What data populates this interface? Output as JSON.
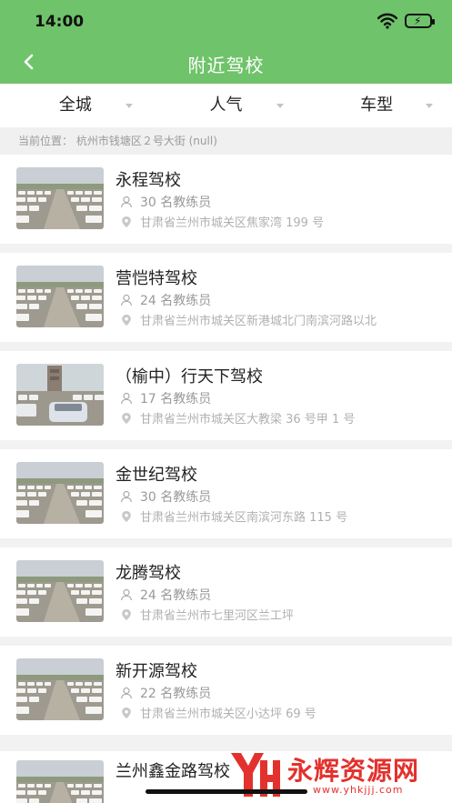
{
  "status_bar": {
    "time": "14:00"
  },
  "nav": {
    "title": "附近驾校"
  },
  "filters": [
    {
      "label": "全城"
    },
    {
      "label": "人气"
    },
    {
      "label": "车型"
    }
  ],
  "location": {
    "text": "当前位置：  杭州市钱塘区２号大街 (null)"
  },
  "schools": [
    {
      "name": "永程驾校",
      "coaches": "30 名教练员",
      "address": "甘肃省兰州市城关区焦家湾 199 号"
    },
    {
      "name": "营恺特驾校",
      "coaches": "24 名教练员",
      "address": "甘肃省兰州市城关区新港城北门南滨河路以北"
    },
    {
      "name": "（榆中）行天下驾校",
      "coaches": "17 名教练员",
      "address": "甘肃省兰州市城关区大教梁 36 号甲 1 号"
    },
    {
      "name": "金世纪驾校",
      "coaches": "30 名教练员",
      "address": "甘肃省兰州市城关区南滨河东路 115 号"
    },
    {
      "name": "龙腾驾校",
      "coaches": "24 名教练员",
      "address": "甘肃省兰州市七里河区兰工坪"
    },
    {
      "name": "新开源驾校",
      "coaches": "22 名教练员",
      "address": "甘肃省兰州市城关区小达坪 69 号"
    }
  ],
  "partial_school": {
    "name": "兰州鑫金路驾校"
  },
  "watermark": {
    "text": "永辉资源网",
    "url": "www.yhkjjj.com"
  },
  "colors": {
    "header": "#6fc36a",
    "watermark": "#e3312d"
  },
  "icons": {
    "back": "chevron-left-icon",
    "coach": "person-icon",
    "address": "location-pin-icon"
  }
}
